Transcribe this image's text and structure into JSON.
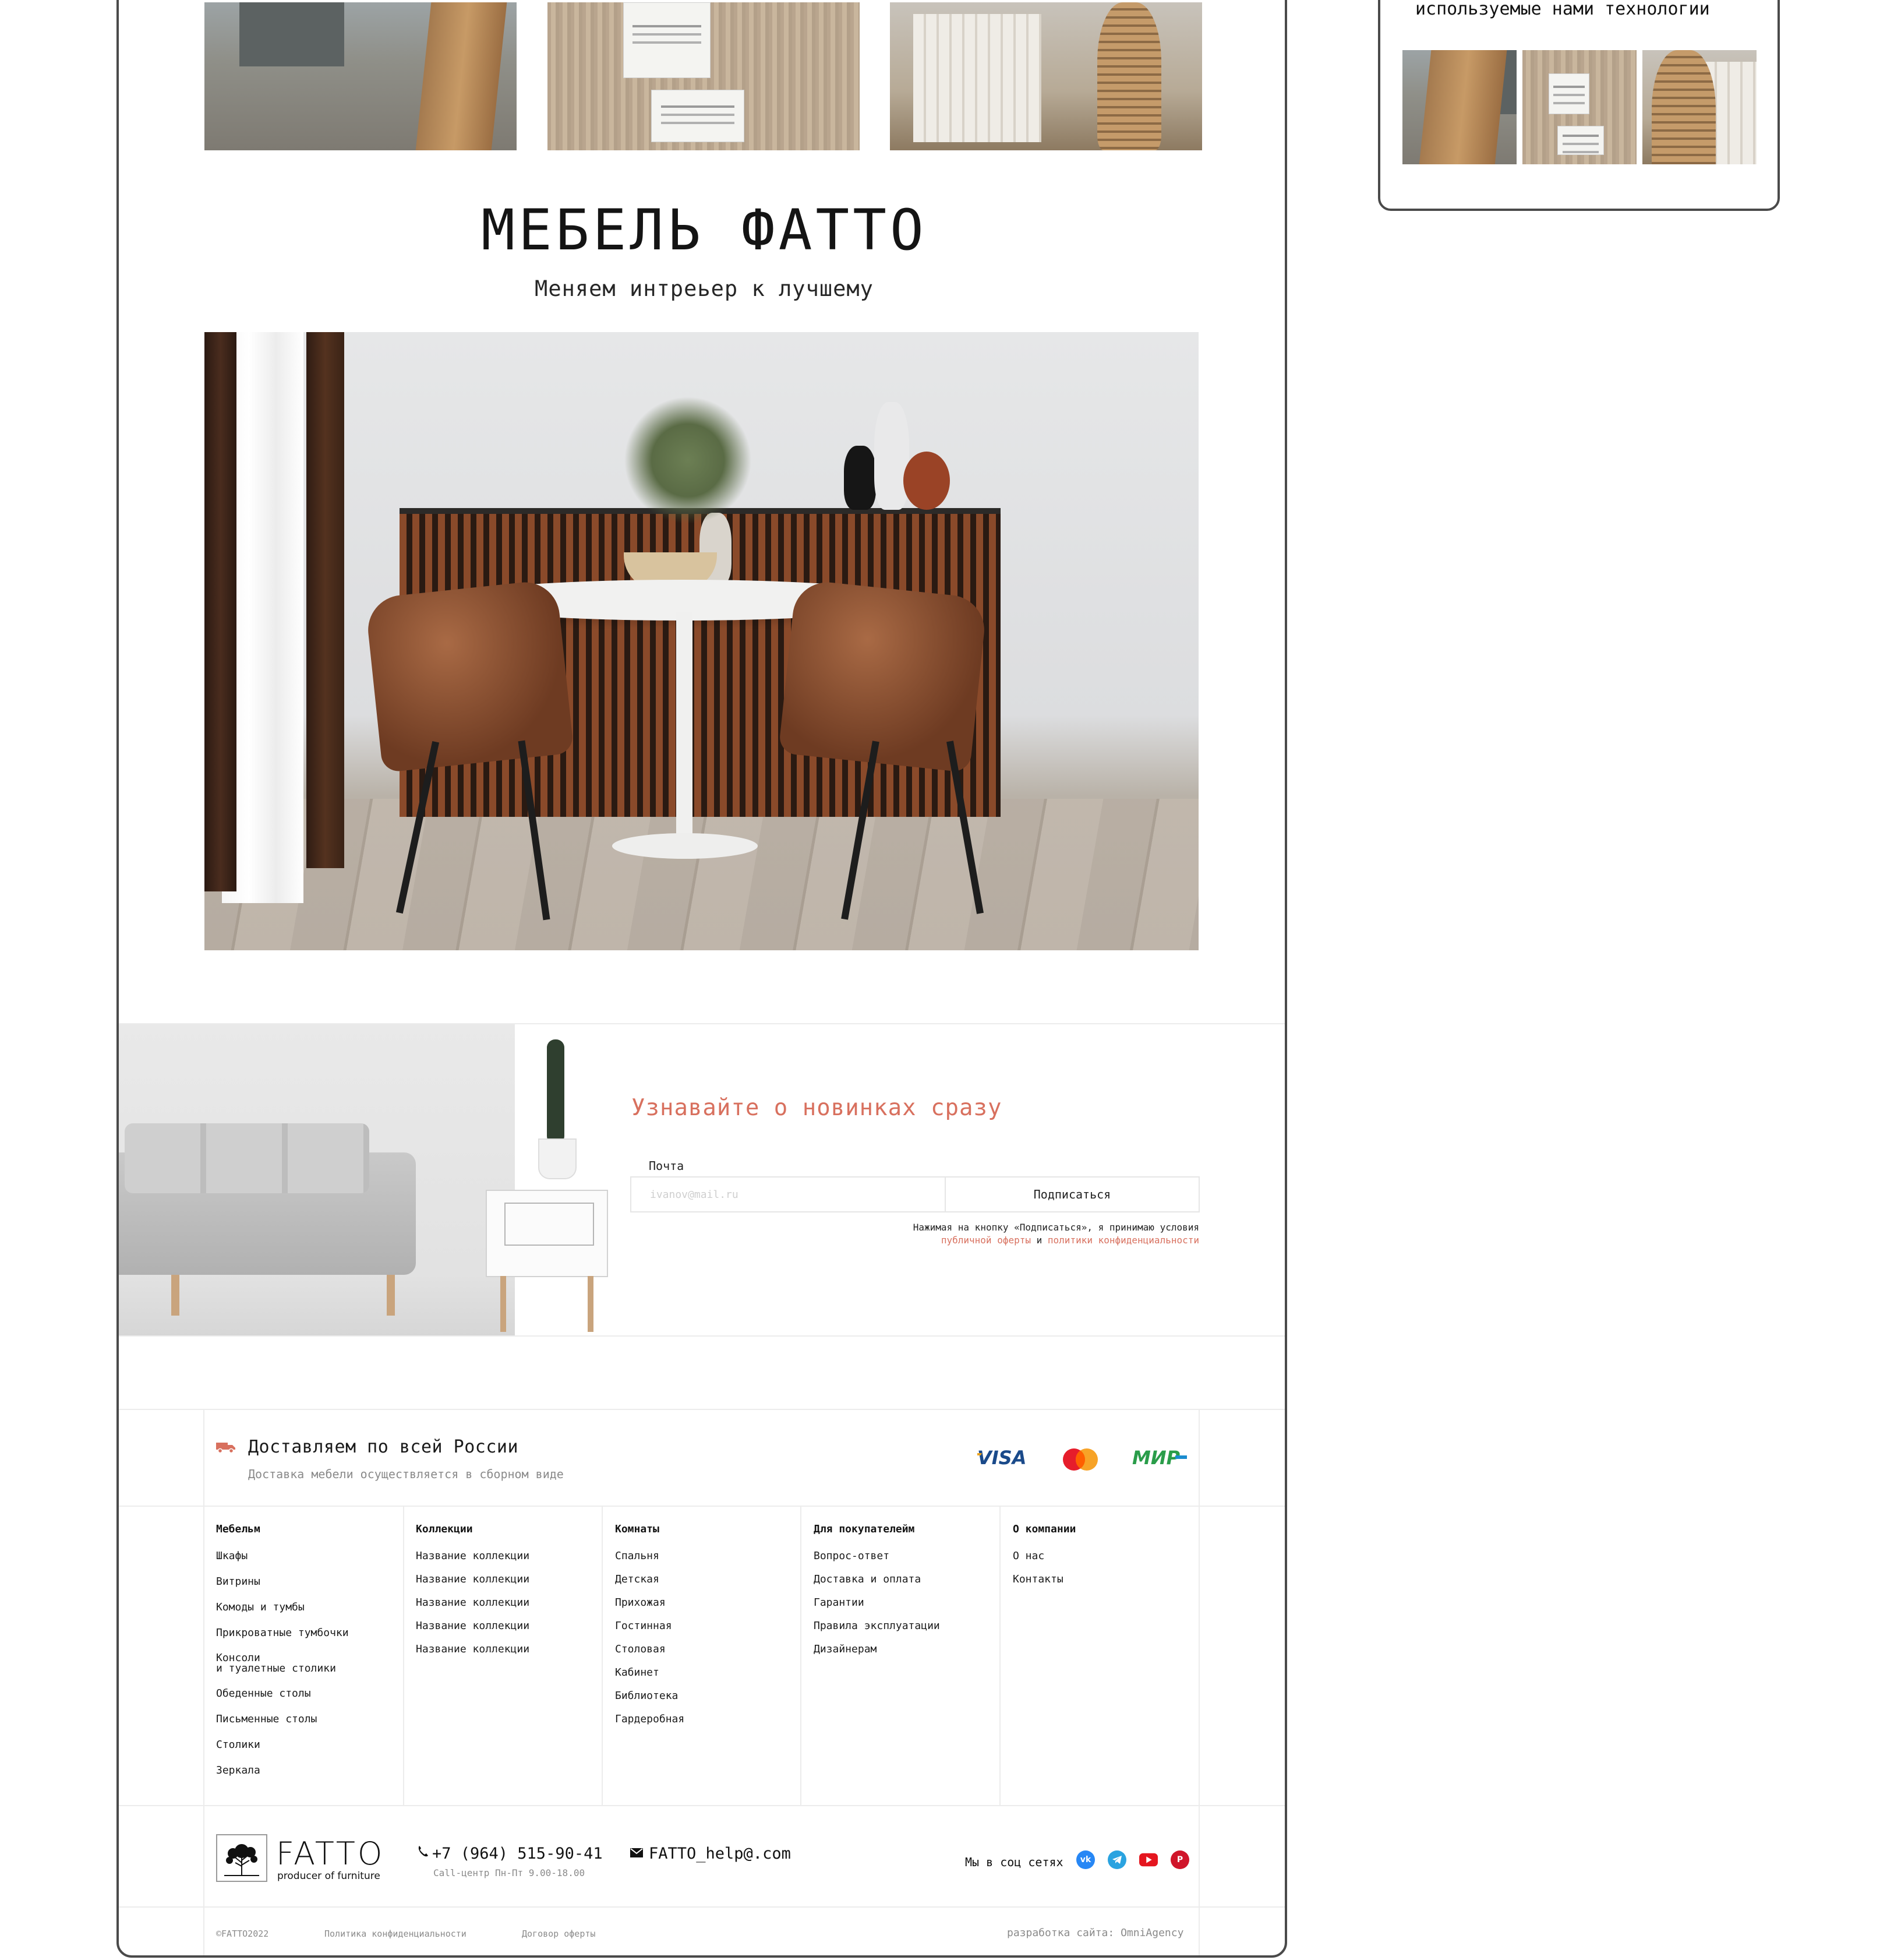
{
  "hero": {
    "title": "МЕБЕЛЬ ФАТТО",
    "subtitle": "Меняем интреьер к лучшему"
  },
  "newsletter": {
    "title": "Узнавайте о новинках сразу",
    "email_label": "Почта",
    "email_placeholder": "ivanov@mail.ru",
    "button_label": "Подписаться",
    "consent_line1": "Нажимая на кнопку «Подписаться», я принимаю условия",
    "consent_offer_link": "публичной оферты",
    "consent_and": "и",
    "consent_privacy_link": "политики конфиденциальности",
    "accent_color": "#d8705e"
  },
  "delivery": {
    "title": "Доставляем по всей России",
    "subtitle": "Доставка мебели осуществляется в сборном виде",
    "icon": "truck-icon"
  },
  "payments": [
    "VISA",
    "Mastercard",
    "МИР"
  ],
  "footer_columns": [
    {
      "heading": "Мебельм",
      "items": [
        "Шкафы",
        "Витрины",
        "Комоды и тумбы",
        "Прикроватные тумбочки",
        "Консоли\nи туалетные столики",
        "Обеденные столы",
        "Письменные столы",
        "Столики",
        "Зеркала"
      ]
    },
    {
      "heading": "Коллекции",
      "items": [
        "Название коллекции",
        "Название коллекции",
        "Название коллекции",
        "Название коллекции",
        "Название коллекции"
      ]
    },
    {
      "heading": "Комнаты",
      "items": [
        "Спальня",
        "Детская",
        "Прихожая",
        "Гостинная",
        "Столовая",
        "Кабинет",
        "Библиотека",
        "Гардеробная"
      ]
    },
    {
      "heading": "Для покупателейм",
      "items": [
        "Вопрос-ответ",
        "Доставка и оплата",
        "Гарантии",
        "Правила эксплуатации",
        "Дизайнерам"
      ]
    },
    {
      "heading": "О компании",
      "items": [
        "О нас",
        "Контакты"
      ]
    }
  ],
  "contacts": {
    "logo_word": "FATTO",
    "logo_tagline": "producer of furniture",
    "phone": "+7 (964) 515-90-41",
    "hours": "Call-центр Пн-Пт 9.00-18.00",
    "email": "FATTO_help@.com",
    "social_label": "Мы в соц сетях",
    "social": [
      "vk-icon",
      "telegram-icon",
      "youtube-icon",
      "pinterest-icon"
    ]
  },
  "bottom": {
    "copyright": "©FATTO2022",
    "privacy": "Политика конфиденциальности",
    "offer": "Договор оферты",
    "developer": "разработка сайта: OmniAgency"
  },
  "side_card": {
    "text": "используемые нами технологии"
  }
}
